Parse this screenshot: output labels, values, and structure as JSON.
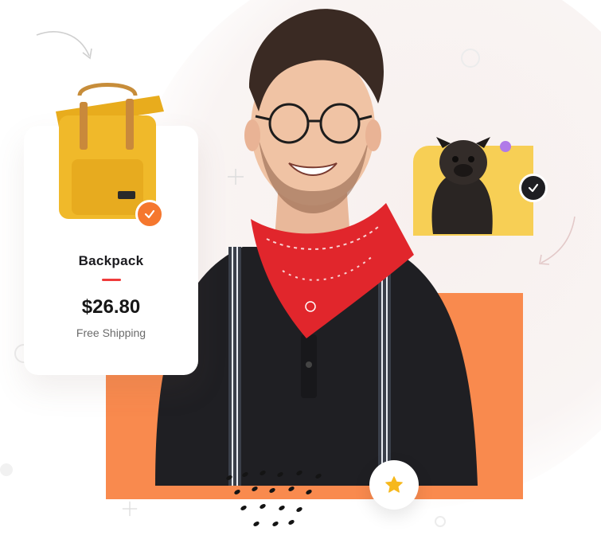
{
  "product_card": {
    "title": "Backpack",
    "price": "$26.80",
    "shipping": "Free Shipping",
    "check_icon": "check-icon"
  },
  "pet_card": {
    "check_icon": "check-icon"
  },
  "rating": {
    "icon": "star-icon"
  },
  "colors": {
    "accent_orange": "#f98a4e",
    "badge_orange": "#f5772e",
    "accent_red": "#ef3b3b",
    "pet_card_yellow": "#f7cf55",
    "badge_dark": "#1e1e22",
    "dot_purple": "#b07ae8",
    "star_yellow": "#f6b81c"
  }
}
